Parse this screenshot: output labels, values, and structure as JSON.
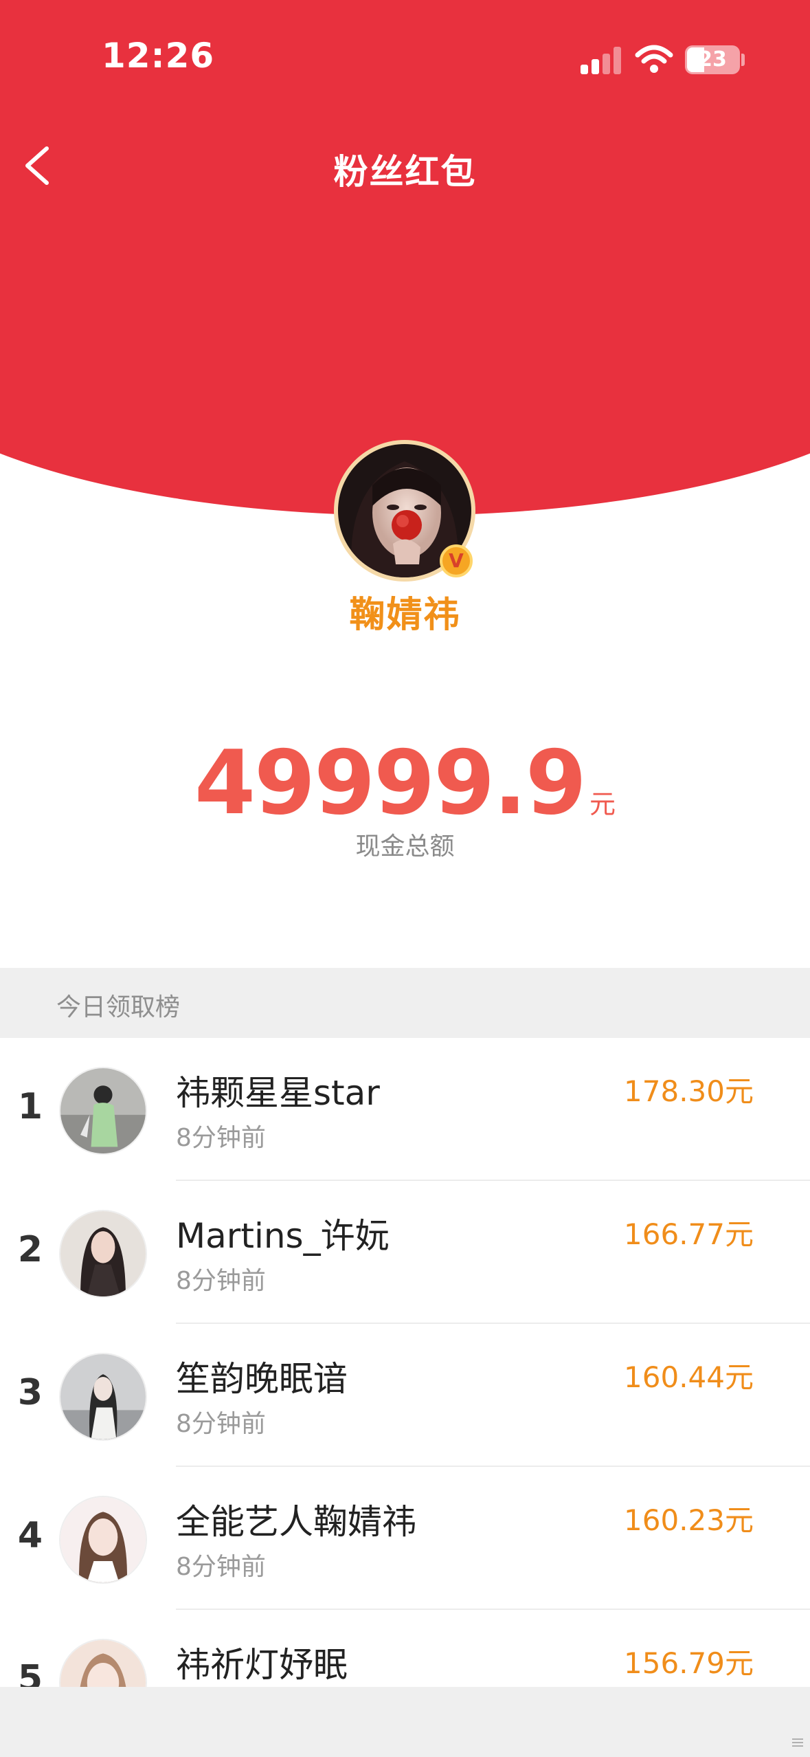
{
  "status_bar": {
    "time": "12:26",
    "battery": "23"
  },
  "nav": {
    "title": "粉丝红包",
    "back_icon": "back-arrow-icon"
  },
  "host": {
    "name": "鞠婧祎",
    "badge": "V"
  },
  "summary": {
    "amount": "49999.9",
    "unit": "元",
    "label": "现金总额"
  },
  "leaderboard": {
    "title": "今日领取榜",
    "rows": [
      {
        "rank": "1",
        "name": "祎颗星星star",
        "time": "8分钟前",
        "amount": "178.30元"
      },
      {
        "rank": "2",
        "name": "Martins_许妧",
        "time": "8分钟前",
        "amount": "166.77元"
      },
      {
        "rank": "3",
        "name": "笙韵晚眠谙",
        "time": "8分钟前",
        "amount": "160.44元"
      },
      {
        "rank": "4",
        "name": "全能艺人鞠婧祎",
        "time": "8分钟前",
        "amount": "160.23元"
      },
      {
        "rank": "5",
        "name": "祎祈灯妤眠",
        "amount": "156.79元"
      }
    ]
  },
  "colors": {
    "header_red": "#e8313e",
    "amount_red": "#f05a4f",
    "amount_orange": "#f08d1a",
    "name_orange": "#f19019"
  }
}
